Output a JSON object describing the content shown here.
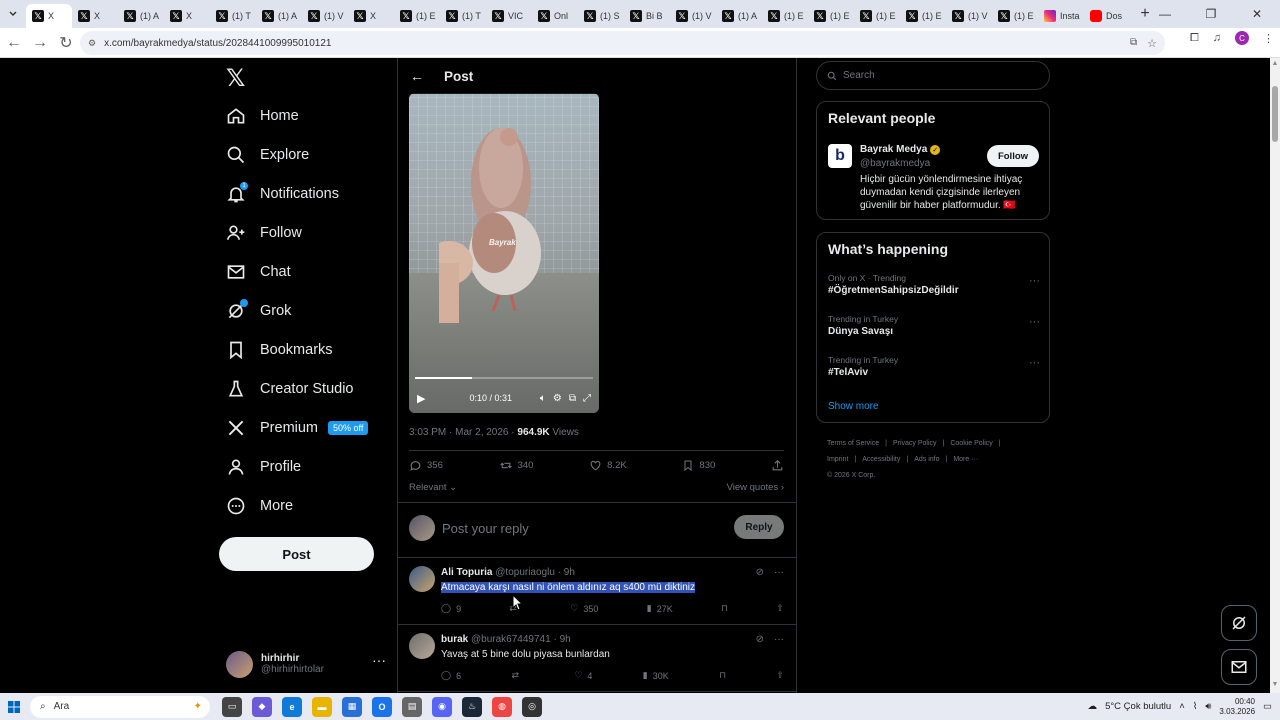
{
  "browser": {
    "tabs": [
      {
        "label": "X",
        "fav": "X"
      },
      {
        "label": "X",
        "fav": "X"
      },
      {
        "label": "(1) A",
        "fav": "X"
      },
      {
        "label": "X",
        "fav": "X"
      },
      {
        "label": "(1) T",
        "fav": "X"
      },
      {
        "label": "(1) A",
        "fav": "X"
      },
      {
        "label": "(1) V",
        "fav": "X"
      },
      {
        "label": "X",
        "fav": "X"
      },
      {
        "label": "(1) E",
        "fav": "X"
      },
      {
        "label": "(1) T",
        "fav": "X"
      },
      {
        "label": "VIC",
        "fav": "X"
      },
      {
        "label": "Onl",
        "fav": "X"
      },
      {
        "label": "(1) S",
        "fav": "X"
      },
      {
        "label": "Bi B",
        "fav": "X"
      },
      {
        "label": "(1) V",
        "fav": "X"
      },
      {
        "label": "(1) A",
        "fav": "X"
      },
      {
        "label": "(1) E",
        "fav": "X"
      },
      {
        "label": "(1) E",
        "fav": "X"
      },
      {
        "label": "(1) E",
        "fav": "X"
      },
      {
        "label": "(1) E",
        "fav": "X"
      },
      {
        "label": "(1) V",
        "fav": "X"
      },
      {
        "label": "(1) E",
        "fav": "X"
      },
      {
        "label": "Insta",
        "fav": "ig"
      },
      {
        "label": "Dos",
        "fav": "yt"
      }
    ],
    "new_tab": "+",
    "url": "x.com/bayrakmedya/status/2028441009995010121",
    "profile_initial": "C"
  },
  "nav": {
    "logo": "𝕏",
    "items": [
      {
        "label": "Home",
        "icon": "home-icon"
      },
      {
        "label": "Explore",
        "icon": "search-icon"
      },
      {
        "label": "Notifications",
        "icon": "bell-icon",
        "badge": "1"
      },
      {
        "label": "Follow",
        "icon": "person-plus-icon"
      },
      {
        "label": "Chat",
        "icon": "mail-icon"
      },
      {
        "label": "Grok",
        "icon": "grok-icon"
      },
      {
        "label": "Bookmarks",
        "icon": "bookmark-icon"
      },
      {
        "label": "Creator Studio",
        "icon": "flask-icon"
      },
      {
        "label": "Premium",
        "icon": "x-icon",
        "badge": "50% off"
      },
      {
        "label": "Profile",
        "icon": "person-icon"
      },
      {
        "label": "More",
        "icon": "more-circle-icon"
      }
    ],
    "post_button": "Post",
    "account": {
      "name": "hirhirhir",
      "handle": "@hirhirhirtolar",
      "more": "···"
    }
  },
  "main": {
    "header_title": "Post",
    "video": {
      "watermark": "Bayrak",
      "time": "0:10 / 0:31",
      "progress_fraction": 0.32
    },
    "meta": {
      "time": "3:03 PM · Mar 2, 2026 · ",
      "views_count": "964.9K",
      "views_label": " Views"
    },
    "stats": {
      "replies": "356",
      "reposts": "340",
      "likes": "8.2K",
      "bookmarks": "830"
    },
    "sort_label": "Relevant",
    "view_quotes": "View quotes",
    "reply_placeholder": "Post your reply",
    "reply_button": "Reply",
    "replies": [
      {
        "name": "Ali Topuria",
        "handle": "@topuriaoglu",
        "age": " · 9h",
        "text": "Atmacaya karşı nasıl ni önlem aldınız aq s400 mü diktiniz",
        "replies": "9",
        "reposts": "",
        "likes": "350",
        "views": "27K"
      },
      {
        "name": "burak",
        "handle": "@burak67449741",
        "age": " · 9h",
        "text": "Yavaş at 5 bine dolu piyasa bunlardan",
        "replies": "6",
        "reposts": "",
        "likes": "4",
        "views": "30K"
      }
    ]
  },
  "right": {
    "search_placeholder": "Search",
    "relevant": {
      "title": "Relevant people",
      "name": "Bayrak Medya",
      "handle": "@bayrakmedya",
      "follow": "Follow",
      "bio": "Hiçbir gücün yönlendirmesine ihtiyaç duymadan kendi çizgisinde ilerleyen güvenilir bir haber platformudur. 🇹🇷",
      "avatar_letter": "b"
    },
    "happening": {
      "title": "What’s happening",
      "trends": [
        {
          "context": "Only on X · Trending",
          "topic": "#ÖğretmenSahipsizDeğildir"
        },
        {
          "context": "Trending in Turkey",
          "topic": "Dünya Savaşı"
        },
        {
          "context": "Trending in Turkey",
          "topic": "#TelAviv"
        }
      ],
      "show_more": "Show more"
    },
    "footer": [
      "Terms of Service",
      "|",
      "Privacy Policy",
      "|",
      "Cookie Policy",
      "|",
      "Imprint",
      "|",
      "Accessibility",
      "|",
      "Ads info",
      "|",
      "More ···",
      "© 2026 X Corp."
    ]
  },
  "taskbar": {
    "search_label": "Ara",
    "weather": "5°C  Çok bulutlu",
    "time": "00:40",
    "date": "3.03.2026"
  },
  "colors": {
    "accent": "#1d9bf0",
    "background": "#000000",
    "border": "#2f3336",
    "muted": "#71767b",
    "selection": "#3153b8"
  }
}
